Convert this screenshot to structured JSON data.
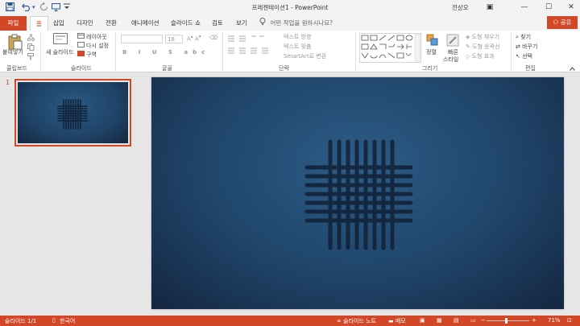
{
  "title_bar": {
    "window_title": "프레젠테이션1  -  PowerPoint",
    "user_name": "전상오",
    "save_icon": "save-icon",
    "undo_icon": "undo-icon",
    "redo_icon": "redo-icon",
    "present_icon": "present-from-start-icon",
    "customize_icon": "customize-qat-icon",
    "minimize": "—",
    "restore": "☐",
    "close": "✕",
    "ribbon_options": "▣"
  },
  "tabs": {
    "file": "파일",
    "home": "홈",
    "insert": "삽입",
    "design": "디자인",
    "transitions": "전환",
    "animations": "애니메이션",
    "slideshow": "슬라이드 쇼",
    "review": "검토",
    "view": "보기",
    "tell_me": "어떤 작업을 원하시나요?",
    "share": "공유"
  },
  "ribbon": {
    "clipboard": {
      "paste": "붙여넣기",
      "label": "클립보드"
    },
    "slides": {
      "new_slide": "새 슬라이드",
      "layout": "레이아웃",
      "reset": "다시 설정",
      "section": "구역",
      "label": "슬라이드"
    },
    "font": {
      "size": "18",
      "label": "글꼴"
    },
    "paragraph": {
      "text_direction": "텍스트 방향",
      "align_text": "텍스트 맞춤",
      "smartart": "SmartArt로 변환",
      "label": "단락"
    },
    "drawing": {
      "arrange": "정렬",
      "quick_styles_1": "빠른",
      "quick_styles_2": "스타일",
      "shape_fill": "도형 채우기",
      "shape_outline": "도형 윤곽선",
      "shape_effects": "도형 효과",
      "label": "그리기"
    },
    "editing": {
      "find": "찾기",
      "replace": "바꾸기",
      "select": "선택",
      "label": "편집"
    }
  },
  "thumbnails": [
    {
      "number": "1"
    }
  ],
  "status_bar": {
    "slide_info": "슬라이드 1/1",
    "language": "한국어",
    "notes": "슬라이드 노트",
    "comments": "메모",
    "zoom": "71%",
    "zoom_minus": "−",
    "zoom_plus": "+"
  },
  "colors": {
    "accent": "#d24726",
    "slide_background": "#1f4468",
    "grid_lines": "#12233a"
  }
}
